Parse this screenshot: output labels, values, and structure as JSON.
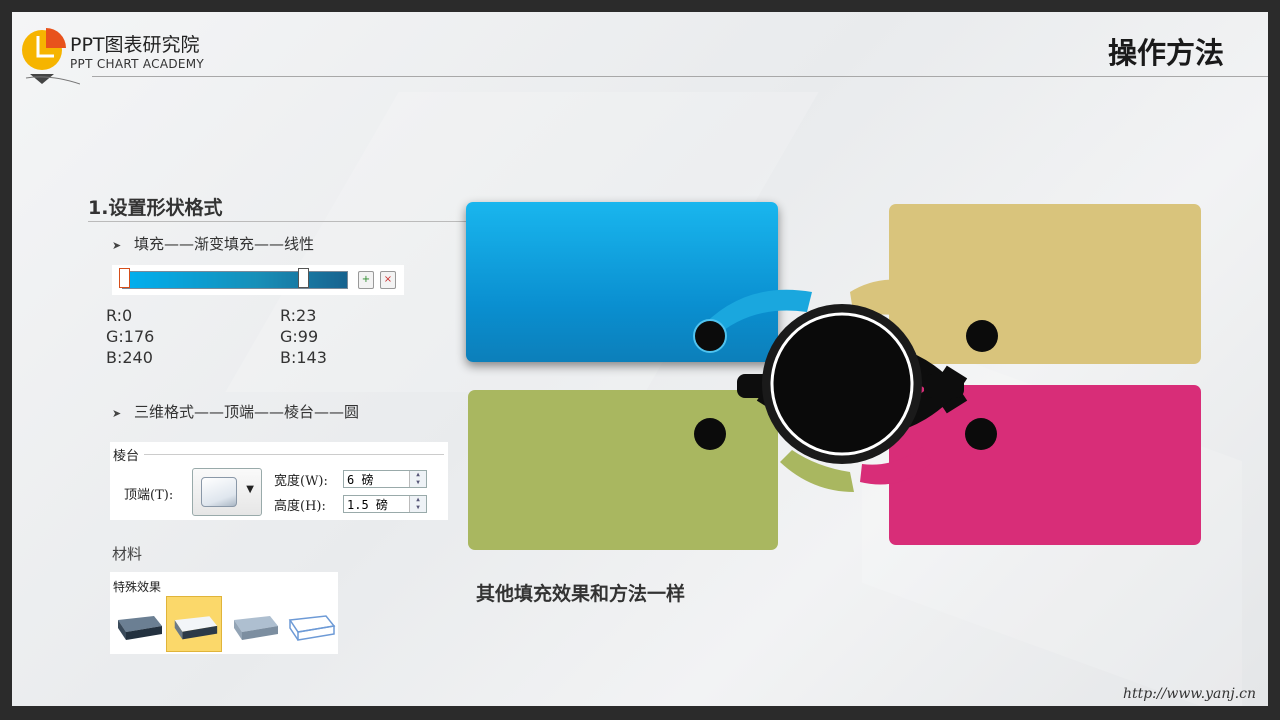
{
  "header": {
    "brand_cn": "PPT图表研究院",
    "brand_en": "PPT CHART ACADEMY",
    "title": "操作方法"
  },
  "section": {
    "title": "1.设置形状格式",
    "bullet1": "填充——渐变填充——线性",
    "bullet2": "三维格式——顶端——棱台——圆"
  },
  "gradient": {
    "stop1": {
      "r": "R:0",
      "g": "G:176",
      "b": "B:240",
      "color": "#00B0F0"
    },
    "stop2": {
      "r": "R:23",
      "g": "G:99",
      "b": "B:143",
      "color": "#17638F"
    }
  },
  "bevel_panel": {
    "heading": "棱台",
    "top_label": "顶端(T):",
    "width_label": "宽度(W):",
    "width_value": "6 磅",
    "height_label": "高度(H):",
    "height_value": "1.5 磅"
  },
  "material": {
    "heading": "材料",
    "panel_heading": "特殊效果",
    "selected_index": 1
  },
  "diagram": {
    "colors": {
      "blue": "#0A9AD8",
      "tan": "#D9C47C",
      "green": "#A9B760",
      "pink": "#D82D78",
      "hub": "#0D0D0D"
    }
  },
  "bottom_note": "其他填充效果和方法一样",
  "footer_url": "http://www.yanj.cn"
}
